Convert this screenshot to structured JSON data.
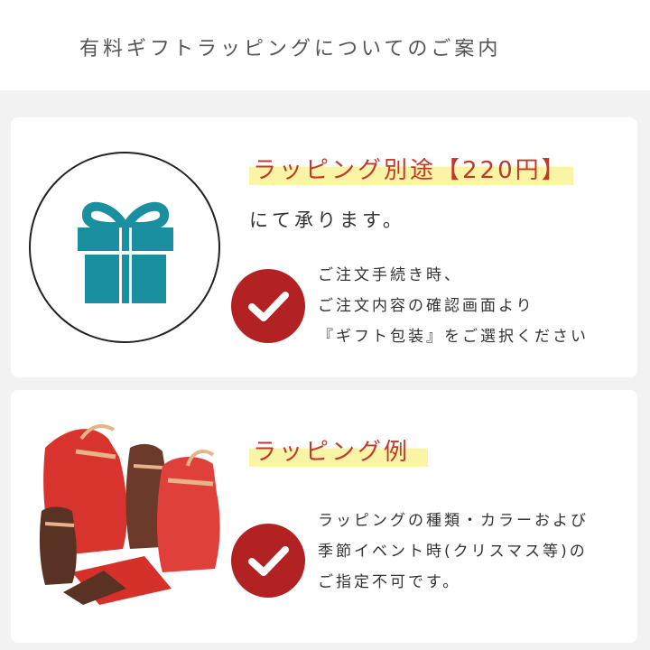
{
  "header": {
    "title": "有料ギフトラッピングについてのご案内"
  },
  "fee_card": {
    "icon": "gift-icon",
    "headline": "ラッピング別途【220円】",
    "subline": "にて承ります。",
    "check_icon": "check-icon",
    "notes": [
      "ご注文手続き時、",
      "ご注文内容の確認画面より",
      "『ギフト包装』をご選択ください"
    ]
  },
  "example_card": {
    "image": "gift-bags-image",
    "headline": "ラッピング例",
    "check_icon": "check-icon",
    "notes": [
      "ラッピングの種類・カラーおよび",
      "季節イベント時(クリスマス等)の",
      "ご指定不可です。"
    ]
  },
  "colors": {
    "accent_red": "#c0392b",
    "check_red": "#b32222",
    "gift_teal": "#1a8fa0",
    "highlight_yellow": "#faf5a6",
    "background": "#f2f2f2"
  }
}
